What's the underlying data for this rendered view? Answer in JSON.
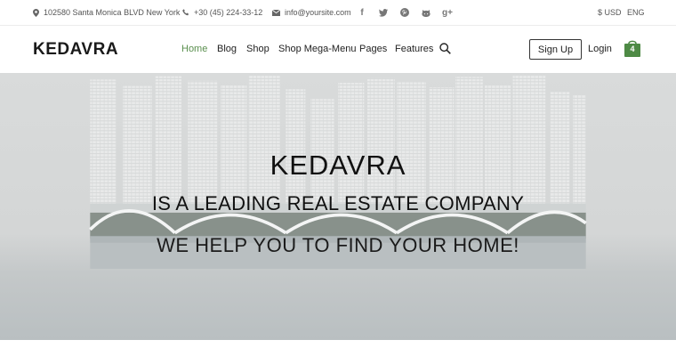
{
  "topbar": {
    "address": "102580 Santa Monica BLVD New York",
    "phone": "+30 (45) 224-33-12",
    "email": "info@yoursite.com",
    "social": [
      {
        "icon": "facebook-icon",
        "glyph": "f"
      },
      {
        "icon": "twitter-icon",
        "glyph": "t"
      },
      {
        "icon": "pinterest-icon",
        "glyph": "p"
      },
      {
        "icon": "github-icon",
        "glyph": "g"
      },
      {
        "icon": "google-plus-icon",
        "glyph": "g+"
      }
    ],
    "currency": "$ USD",
    "language": "ENG"
  },
  "nav": {
    "logo": "KEDAVRA",
    "links": [
      "Home",
      "Blog",
      "Shop",
      "Shop Mega-Menu",
      "Pages",
      "Features"
    ],
    "active": "Home",
    "signup": "Sign Up",
    "login": "Login",
    "cart_count": "4"
  },
  "hero": {
    "title": "KEDAVRA",
    "subtitle": "IS A LEADING REAL ESTATE COMPANY",
    "tagline": "WE HELP YOU TO FIND YOUR HOME!"
  },
  "colors": {
    "accent": "#5a8f4e",
    "cart": "#4e8a45"
  }
}
